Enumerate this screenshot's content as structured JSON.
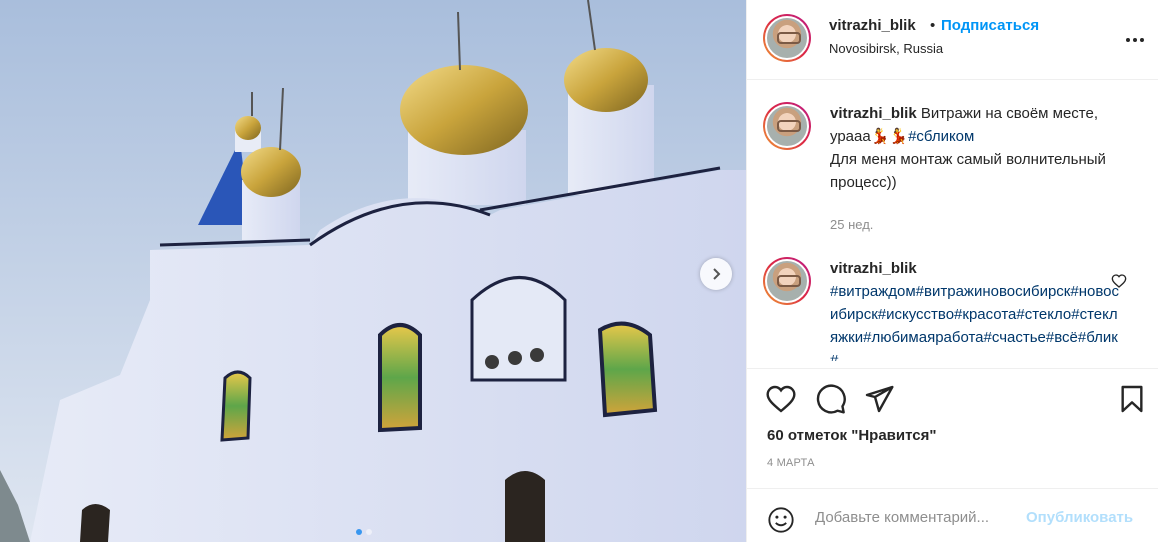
{
  "post": {
    "username": "vitrazhi_blik",
    "separator": "•",
    "follow_label": "Подписаться",
    "location": "Novosibirsk, Russia"
  },
  "caption": {
    "username": "vitrazhi_blik",
    "text_plain": "Витражи на своём месте, урааа",
    "emoji": "💃💃",
    "hashtag": "#сбликом",
    "text_plain2": "Для меня монтаж самый волнительный процесс))",
    "time": "25 нед."
  },
  "comment": {
    "username": "vitrazhi_blik",
    "hashtags": "#витраждом#витражиновосибирск#новосибирск#искусство#красота#стекло#стекляжки#любимаяработа#счастье#всё#блик#"
  },
  "likes_text": "60 отметок \"Нравится\"",
  "date": "4 МАРТА",
  "add_comment": {
    "placeholder": "Добавьте комментарий...",
    "publish_label": "Опубликовать"
  },
  "carousel": {
    "slides": 2,
    "active": 1
  },
  "colors": {
    "accent": "#0095f6",
    "hashtag": "#00376b",
    "muted": "#8e8e8e",
    "sky": "#c9d6e8",
    "dome_gold": "#c9a43c",
    "church_wall": "#eef1fb"
  },
  "icons": [
    "more-icon",
    "heart-icon",
    "comment-icon",
    "share-icon",
    "bookmark-icon",
    "emoji-icon",
    "chevron-right-icon"
  ]
}
